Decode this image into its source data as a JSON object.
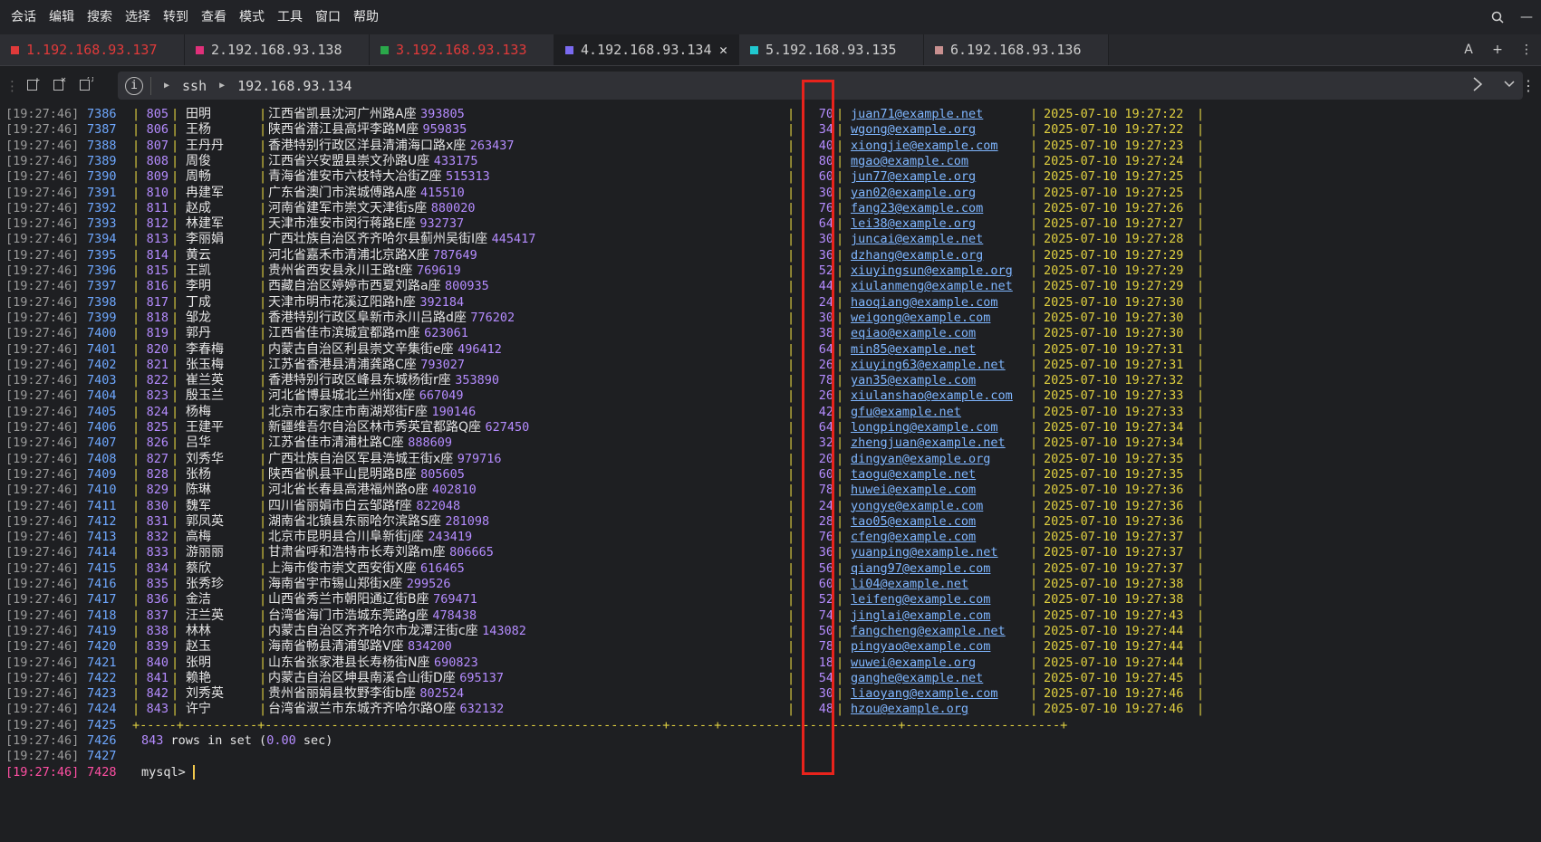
{
  "menubar": {
    "items": [
      "会话",
      "编辑",
      "搜索",
      "选择",
      "转到",
      "查看",
      "模式",
      "工具",
      "窗口",
      "帮助"
    ]
  },
  "tabs": [
    {
      "label": "1.192.168.93.137",
      "color": "#e03a3a",
      "text_color": "#e03a3a"
    },
    {
      "label": "2.192.168.93.138",
      "color": "#e0307a",
      "text_color": "#cfcfcf"
    },
    {
      "label": "3.192.168.93.133",
      "color": "#2aa84a",
      "text_color": "#e03a3a"
    },
    {
      "label": "4.192.168.93.134",
      "color": "#7a6af0",
      "text_color": "#cfcfcf",
      "active": true
    },
    {
      "label": "5.192.168.93.135",
      "color": "#20c8d0",
      "text_color": "#cfcfcf"
    },
    {
      "label": "6.192.168.93.136",
      "color": "#c89090",
      "text_color": "#cfcfcf"
    }
  ],
  "tabbar_right": {
    "font_icon": "A",
    "add_icon": "+",
    "more_icon": "⋮"
  },
  "addressbar": {
    "protocol": "ssh",
    "host": "192.168.93.134"
  },
  "rows": [
    {
      "ts": "[19:27:46]",
      "ln": "7386",
      "id": "805",
      "name": "田明",
      "addr": "江西省凯县沈河广州路A座",
      "zip": "393805",
      "age": "70",
      "email": "juan71@example.net",
      "date": "2025-07-10 19:27:22"
    },
    {
      "ts": "[19:27:46]",
      "ln": "7387",
      "id": "806",
      "name": "王杨",
      "addr": "陕西省潜江县高坪李路M座",
      "zip": "959835",
      "age": "34",
      "email": "wgong@example.org",
      "date": "2025-07-10 19:27:22"
    },
    {
      "ts": "[19:27:46]",
      "ln": "7388",
      "id": "807",
      "name": "王丹丹",
      "addr": "香港特别行政区洋县清浦海口路x座",
      "zip": "263437",
      "age": "40",
      "email": "xiongjie@example.com",
      "date": "2025-07-10 19:27:23"
    },
    {
      "ts": "[19:27:46]",
      "ln": "7389",
      "id": "808",
      "name": "周俊",
      "addr": "江西省兴安盟县崇文孙路U座",
      "zip": "433175",
      "age": "80",
      "email": "mgao@example.com",
      "date": "2025-07-10 19:27:24"
    },
    {
      "ts": "[19:27:46]",
      "ln": "7390",
      "id": "809",
      "name": "周畅",
      "addr": "青海省淮安市六枝特大冶街Z座",
      "zip": "515313",
      "age": "60",
      "email": "jun77@example.org",
      "date": "2025-07-10 19:27:25"
    },
    {
      "ts": "[19:27:46]",
      "ln": "7391",
      "id": "810",
      "name": "冉建军",
      "addr": "广东省澳门市滨城傅路A座",
      "zip": "415510",
      "age": "30",
      "email": "yan02@example.org",
      "date": "2025-07-10 19:27:25"
    },
    {
      "ts": "[19:27:46]",
      "ln": "7392",
      "id": "811",
      "name": "赵成",
      "addr": "河南省建军市崇文天津街s座",
      "zip": "880020",
      "age": "76",
      "email": "fang23@example.com",
      "date": "2025-07-10 19:27:26"
    },
    {
      "ts": "[19:27:46]",
      "ln": "7393",
      "id": "812",
      "name": "林建军",
      "addr": "天津市淮安市闵行蒋路E座",
      "zip": "932737",
      "age": "64",
      "email": "lei38@example.org",
      "date": "2025-07-10 19:27:27"
    },
    {
      "ts": "[19:27:46]",
      "ln": "7394",
      "id": "813",
      "name": "李丽娟",
      "addr": "广西壮族自治区齐齐哈尔县蓟州吴街I座",
      "zip": "445417",
      "age": "30",
      "email": "juncai@example.net",
      "date": "2025-07-10 19:27:28"
    },
    {
      "ts": "[19:27:46]",
      "ln": "7395",
      "id": "814",
      "name": "黄云",
      "addr": "河北省嘉禾市清浦北京路X座",
      "zip": "787649",
      "age": "36",
      "email": "dzhang@example.org",
      "date": "2025-07-10 19:27:29"
    },
    {
      "ts": "[19:27:46]",
      "ln": "7396",
      "id": "815",
      "name": "王凯",
      "addr": "贵州省西安县永川王路t座",
      "zip": "769619",
      "age": "52",
      "email": "xiuyingsun@example.org",
      "date": "2025-07-10 19:27:29"
    },
    {
      "ts": "[19:27:46]",
      "ln": "7397",
      "id": "816",
      "name": "李明",
      "addr": "西藏自治区婷婷市西夏刘路a座",
      "zip": "800935",
      "age": "44",
      "email": "xiulanmeng@example.net",
      "date": "2025-07-10 19:27:29"
    },
    {
      "ts": "[19:27:46]",
      "ln": "7398",
      "id": "817",
      "name": "丁成",
      "addr": "天津市明市花溪辽阳路h座",
      "zip": "392184",
      "age": "24",
      "email": "haoqiang@example.com",
      "date": "2025-07-10 19:27:30"
    },
    {
      "ts": "[19:27:46]",
      "ln": "7399",
      "id": "818",
      "name": "邹龙",
      "addr": "香港特别行政区阜新市永川吕路d座",
      "zip": "776202",
      "age": "30",
      "email": "weigong@example.com",
      "date": "2025-07-10 19:27:30"
    },
    {
      "ts": "[19:27:46]",
      "ln": "7400",
      "id": "819",
      "name": "郭丹",
      "addr": "江西省佳市滨城宜都路m座",
      "zip": "623061",
      "age": "38",
      "email": "eqiao@example.com",
      "date": "2025-07-10 19:27:30"
    },
    {
      "ts": "[19:27:46]",
      "ln": "7401",
      "id": "820",
      "name": "李春梅",
      "addr": "内蒙古自治区利县崇文辛集街e座",
      "zip": "496412",
      "age": "64",
      "email": "min85@example.net",
      "date": "2025-07-10 19:27:31"
    },
    {
      "ts": "[19:27:46]",
      "ln": "7402",
      "id": "821",
      "name": "张玉梅",
      "addr": "江苏省香港县清浦龚路C座",
      "zip": "793027",
      "age": "26",
      "email": "xiuying63@example.net",
      "date": "2025-07-10 19:27:31"
    },
    {
      "ts": "[19:27:46]",
      "ln": "7403",
      "id": "822",
      "name": "崔兰英",
      "addr": "香港特别行政区峰县东城杨街r座",
      "zip": "353890",
      "age": "78",
      "email": "yan35@example.com",
      "date": "2025-07-10 19:27:32"
    },
    {
      "ts": "[19:27:46]",
      "ln": "7404",
      "id": "823",
      "name": "殷玉兰",
      "addr": "河北省博县城北兰州街x座",
      "zip": "667049",
      "age": "26",
      "email": "xiulanshao@example.com",
      "date": "2025-07-10 19:27:33"
    },
    {
      "ts": "[19:27:46]",
      "ln": "7405",
      "id": "824",
      "name": "杨梅",
      "addr": "北京市石家庄市南湖郑街F座",
      "zip": "190146",
      "age": "42",
      "email": "gfu@example.net",
      "date": "2025-07-10 19:27:33"
    },
    {
      "ts": "[19:27:46]",
      "ln": "7406",
      "id": "825",
      "name": "王建平",
      "addr": "新疆维吾尔自治区林市秀英宜都路Q座",
      "zip": "627450",
      "age": "64",
      "email": "longping@example.com",
      "date": "2025-07-10 19:27:34"
    },
    {
      "ts": "[19:27:46]",
      "ln": "7407",
      "id": "826",
      "name": "吕华",
      "addr": "江苏省佳市清浦杜路C座",
      "zip": "888609",
      "age": "32",
      "email": "zhengjuan@example.net",
      "date": "2025-07-10 19:27:34"
    },
    {
      "ts": "[19:27:46]",
      "ln": "7408",
      "id": "827",
      "name": "刘秀华",
      "addr": "广西壮族自治区军县浩城王街x座",
      "zip": "979716",
      "age": "20",
      "email": "dingyan@example.org",
      "date": "2025-07-10 19:27:35"
    },
    {
      "ts": "[19:27:46]",
      "ln": "7409",
      "id": "828",
      "name": "张杨",
      "addr": "陕西省帆县平山昆明路B座",
      "zip": "805605",
      "age": "60",
      "email": "taogu@example.net",
      "date": "2025-07-10 19:27:35"
    },
    {
      "ts": "[19:27:46]",
      "ln": "7410",
      "id": "829",
      "name": "陈琳",
      "addr": "河北省长春县高港福州路o座",
      "zip": "402810",
      "age": "78",
      "email": "huwei@example.com",
      "date": "2025-07-10 19:27:36"
    },
    {
      "ts": "[19:27:46]",
      "ln": "7411",
      "id": "830",
      "name": "魏军",
      "addr": "四川省丽娟市白云邹路f座",
      "zip": "822048",
      "age": "24",
      "email": "yongye@example.com",
      "date": "2025-07-10 19:27:36"
    },
    {
      "ts": "[19:27:46]",
      "ln": "7412",
      "id": "831",
      "name": "郭凤英",
      "addr": "湖南省北镇县东丽哈尔滨路S座",
      "zip": "281098",
      "age": "28",
      "email": "tao05@example.com",
      "date": "2025-07-10 19:27:36"
    },
    {
      "ts": "[19:27:46]",
      "ln": "7413",
      "id": "832",
      "name": "高梅",
      "addr": "北京市昆明县合川阜新街j座",
      "zip": "243419",
      "age": "76",
      "email": "cfeng@example.com",
      "date": "2025-07-10 19:27:37"
    },
    {
      "ts": "[19:27:46]",
      "ln": "7414",
      "id": "833",
      "name": "游丽丽",
      "addr": "甘肃省呼和浩特市长寿刘路m座",
      "zip": "806665",
      "age": "36",
      "email": "yuanping@example.net",
      "date": "2025-07-10 19:27:37"
    },
    {
      "ts": "[19:27:46]",
      "ln": "7415",
      "id": "834",
      "name": "蔡欣",
      "addr": "上海市俊市崇文西安街X座",
      "zip": "616465",
      "age": "56",
      "email": "qiang97@example.com",
      "date": "2025-07-10 19:27:37"
    },
    {
      "ts": "[19:27:46]",
      "ln": "7416",
      "id": "835",
      "name": "张秀珍",
      "addr": "海南省宇市锡山郑街x座",
      "zip": "299526",
      "age": "60",
      "email": "li04@example.net",
      "date": "2025-07-10 19:27:38"
    },
    {
      "ts": "[19:27:46]",
      "ln": "7417",
      "id": "836",
      "name": "金洁",
      "addr": "山西省秀兰市朝阳通辽街B座",
      "zip": "769471",
      "age": "52",
      "email": "leifeng@example.com",
      "date": "2025-07-10 19:27:38"
    },
    {
      "ts": "[19:27:46]",
      "ln": "7418",
      "id": "837",
      "name": "汪兰英",
      "addr": "台湾省海门市浩城东莞路g座",
      "zip": "478438",
      "age": "74",
      "email": "jinglai@example.com",
      "date": "2025-07-10 19:27:43"
    },
    {
      "ts": "[19:27:46]",
      "ln": "7419",
      "id": "838",
      "name": "林林",
      "addr": "内蒙古自治区齐齐哈尔市龙潭汪街c座",
      "zip": "143082",
      "age": "50",
      "email": "fangcheng@example.net",
      "date": "2025-07-10 19:27:44"
    },
    {
      "ts": "[19:27:46]",
      "ln": "7420",
      "id": "839",
      "name": "赵玉",
      "addr": "海南省畅县清浦邹路V座",
      "zip": "834200",
      "age": "78",
      "email": "pingyao@example.com",
      "date": "2025-07-10 19:27:44"
    },
    {
      "ts": "[19:27:46]",
      "ln": "7421",
      "id": "840",
      "name": "张明",
      "addr": "山东省张家港县长寿杨街N座",
      "zip": "690823",
      "age": "18",
      "email": "wuwei@example.org",
      "date": "2025-07-10 19:27:44"
    },
    {
      "ts": "[19:27:46]",
      "ln": "7422",
      "id": "841",
      "name": "赖艳",
      "addr": "内蒙古自治区坤县南溪合山街D座",
      "zip": "695137",
      "age": "54",
      "email": "ganghe@example.net",
      "date": "2025-07-10 19:27:45"
    },
    {
      "ts": "[19:27:46]",
      "ln": "7423",
      "id": "842",
      "name": "刘秀英",
      "addr": "贵州省丽娟县牧野李街b座",
      "zip": "802524",
      "age": "30",
      "email": "liaoyang@example.com",
      "date": "2025-07-10 19:27:46"
    },
    {
      "ts": "[19:27:46]",
      "ln": "7424",
      "id": "843",
      "name": "许宁",
      "addr": "台湾省淑兰市东城齐齐哈尔路O座",
      "zip": "632132",
      "age": "48",
      "email": "hzou@example.org",
      "date": "2025-07-10 19:27:46"
    }
  ],
  "footer_lines": [
    {
      "ts": "[19:27:46]",
      "ln": "7425",
      "text": "+-----+----------+------------------------------------------------------+------+------------------------+---------------------+"
    },
    {
      "ts": "[19:27:46]",
      "ln": "7426",
      "text_rows": "843",
      "text_rest": " rows in set (",
      "text_time": "0.00",
      "text_end": " sec)"
    },
    {
      "ts": "[19:27:46]",
      "ln": "7427",
      "text": ""
    },
    {
      "ts": "[19:27:46]",
      "ln": "7428",
      "prompt": "mysql>"
    }
  ],
  "colors": {
    "highlight_box": "#e8231c",
    "table_lines": "#e0d040",
    "number": "#b58cff",
    "email": "#7fb6ff",
    "prompt_ts": "#ff4fa3"
  }
}
